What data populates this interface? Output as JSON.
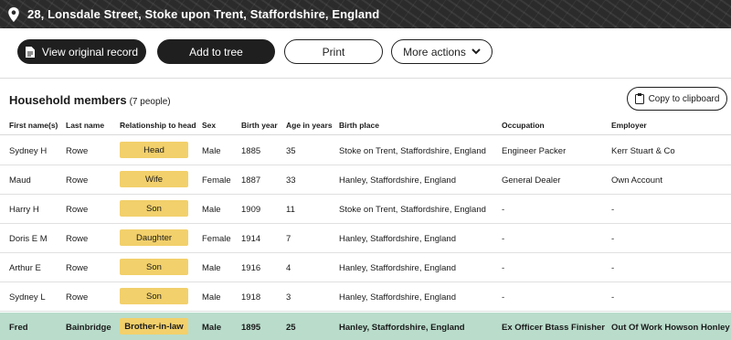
{
  "location": {
    "address": "28, Lonsdale Street, Stoke upon Trent, Staffordshire, England"
  },
  "toolbar": {
    "view_record_label": "View original record",
    "add_to_tree_label": "Add to tree",
    "print_label": "Print",
    "more_actions_label": "More actions"
  },
  "household": {
    "title": "Household members",
    "count_text": "(7 people)",
    "copy_label": "Copy to clipboard",
    "columns": [
      "First name(s)",
      "Last name",
      "Relationship to head",
      "Sex",
      "Birth year",
      "Age in years",
      "Birth place",
      "Occupation",
      "Employer"
    ],
    "rows": [
      {
        "first": "Sydney H",
        "last": "Rowe",
        "relationship": "Head",
        "sex": "Male",
        "birth_year": "1885",
        "age": "35",
        "birth_place": "Stoke on Trent, Staffordshire, England",
        "occupation": "Engineer Packer",
        "employer": "Kerr Stuart & Co"
      },
      {
        "first": "Maud",
        "last": "Rowe",
        "relationship": "Wife",
        "sex": "Female",
        "birth_year": "1887",
        "age": "33",
        "birth_place": "Hanley, Staffordshire, England",
        "occupation": "General Dealer",
        "employer": "Own Account"
      },
      {
        "first": "Harry H",
        "last": "Rowe",
        "relationship": "Son",
        "sex": "Male",
        "birth_year": "1909",
        "age": "11",
        "birth_place": "Stoke on Trent, Staffordshire, England",
        "occupation": "-",
        "employer": "-"
      },
      {
        "first": "Doris E M",
        "last": "Rowe",
        "relationship": "Daughter",
        "sex": "Female",
        "birth_year": "1914",
        "age": "7",
        "birth_place": "Hanley, Staffordshire, England",
        "occupation": "-",
        "employer": "-"
      },
      {
        "first": "Arthur E",
        "last": "Rowe",
        "relationship": "Son",
        "sex": "Male",
        "birth_year": "1916",
        "age": "4",
        "birth_place": "Hanley, Staffordshire, England",
        "occupation": "-",
        "employer": "-"
      },
      {
        "first": "Sydney L",
        "last": "Rowe",
        "relationship": "Son",
        "sex": "Male",
        "birth_year": "1918",
        "age": "3",
        "birth_place": "Hanley, Staffordshire, England",
        "occupation": "-",
        "employer": "-"
      },
      {
        "first": "Fred",
        "last": "Bainbridge",
        "relationship": "Brother-in-law",
        "sex": "Male",
        "birth_year": "1895",
        "age": "25",
        "birth_place": "Hanley, Staffordshire, England",
        "occupation": "Ex Officer Btass Finisher",
        "employer": "Out Of Work Howson Honley"
      }
    ]
  },
  "icons": {
    "location": "map-pin-icon",
    "record": "document-icon",
    "more": "chevron-down-icon",
    "copy": "clipboard-icon"
  },
  "colors": {
    "dark_button": "#1f1f1f",
    "relationship_badge": "#f2d06b",
    "highlight_row": "#b9dccb"
  }
}
